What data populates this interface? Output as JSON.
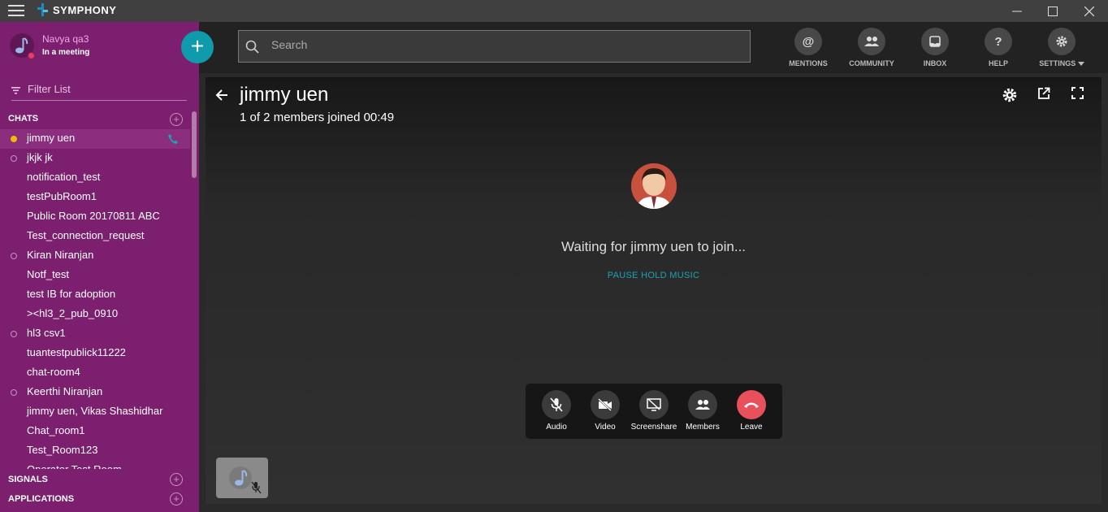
{
  "app": {
    "name": "SYMPHONY"
  },
  "window_controls": [
    "minimize",
    "maximize",
    "close"
  ],
  "user": {
    "name": "Navya qa3",
    "status": "In a meeting"
  },
  "filter": {
    "placeholder": "Filter List"
  },
  "sections": {
    "chats": "CHATS",
    "signals": "SIGNALS",
    "applications": "APPLICATIONS"
  },
  "chats": [
    {
      "name": "jimmy uen",
      "presence": "away",
      "active": true,
      "in_call": true
    },
    {
      "name": "jkjk jk",
      "presence": "offline"
    },
    {
      "name": "notification_test",
      "presence": "none"
    },
    {
      "name": "testPubRoom1",
      "presence": "none"
    },
    {
      "name": "Public Room 20170811 ABC",
      "presence": "none"
    },
    {
      "name": "Test_connection_request",
      "presence": "none"
    },
    {
      "name": "Kiran Niranjan",
      "presence": "offline"
    },
    {
      "name": "Notf_test",
      "presence": "none"
    },
    {
      "name": "test IB for adoption",
      "presence": "none"
    },
    {
      "name": "><hl3_2_pub_0910",
      "presence": "none"
    },
    {
      "name": "hl3 csv1",
      "presence": "offline"
    },
    {
      "name": "tuantestpublick11222",
      "presence": "none"
    },
    {
      "name": "chat-room4",
      "presence": "none"
    },
    {
      "name": "Keerthi Niranjan",
      "presence": "offline"
    },
    {
      "name": "jimmy uen, Vikas Shashidhar",
      "presence": "none"
    },
    {
      "name": "Chat_room1",
      "presence": "none"
    },
    {
      "name": "Test_Room123",
      "presence": "none"
    },
    {
      "name": "Operator Test Room",
      "presence": "none"
    }
  ],
  "search": {
    "placeholder": "Search"
  },
  "nav": {
    "mentions": "MENTIONS",
    "community": "COMMUNITY",
    "inbox": "INBOX",
    "help": "HELP",
    "settings": "SETTINGS"
  },
  "call": {
    "title": "jimmy uen",
    "subtitle": "1 of 2 members joined 00:49",
    "waiting": "Waiting for jimmy uen to join...",
    "pause_music": "PAUSE HOLD MUSIC"
  },
  "controls": {
    "audio": "Audio",
    "video": "Video",
    "screenshare": "Screenshare",
    "members": "Members",
    "leave": "Leave"
  },
  "colors": {
    "sidebar": "#7b1f6e",
    "accent": "#0f9bab",
    "leave": "#e8505b",
    "link": "#1aa3b6"
  }
}
